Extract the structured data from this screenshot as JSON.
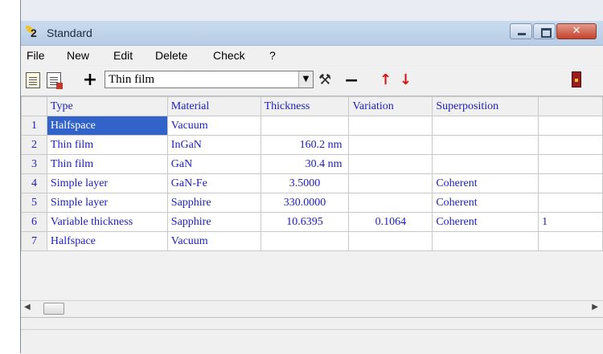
{
  "window": {
    "title": "Standard",
    "min_glyph": "",
    "max_glyph": "",
    "close_glyph": "✕"
  },
  "menu": [
    "File",
    "New",
    "Edit",
    "Delete",
    "Check",
    "?"
  ],
  "toolbar": {
    "layer_type_value": "Thin film",
    "dropdown_glyph": "▼",
    "plus_glyph": "+",
    "minus_glyph": "−",
    "up_glyph": "↑",
    "down_glyph": "↓",
    "wand_glyph": "⚒"
  },
  "table": {
    "columns": [
      "Type",
      "Material",
      "Thickness",
      "Variation",
      "Superposition",
      ""
    ],
    "rows": [
      {
        "n": "1",
        "type": "Halfspace",
        "material": "Vacuum",
        "thickness": "",
        "variation": "",
        "superposition": "",
        "extra": ""
      },
      {
        "n": "2",
        "type": "Thin film",
        "material": "InGaN",
        "thickness": "160.2 nm",
        "variation": "",
        "superposition": "",
        "extra": ""
      },
      {
        "n": "3",
        "type": "Thin film",
        "material": "GaN",
        "thickness": "30.4 nm",
        "variation": "",
        "superposition": "",
        "extra": ""
      },
      {
        "n": "4",
        "type": "Simple layer",
        "material": "GaN-Fe",
        "thickness": "3.5000",
        "variation": "",
        "superposition": "Coherent",
        "extra": ""
      },
      {
        "n": "5",
        "type": "Simple layer",
        "material": "Sapphire",
        "thickness": "330.0000",
        "variation": "",
        "superposition": "Coherent",
        "extra": ""
      },
      {
        "n": "6",
        "type": "Variable thickness",
        "material": "Sapphire",
        "thickness": "10.6395",
        "variation": "0.1064",
        "superposition": "Coherent",
        "extra": "1"
      },
      {
        "n": "7",
        "type": "Halfspace",
        "material": "Vacuum",
        "thickness": "",
        "variation": "",
        "superposition": "",
        "extra": ""
      }
    ]
  },
  "scroll": {
    "left_glyph": "◀",
    "right_glyph": "▶"
  },
  "icons": [
    "app-icon",
    "new-document-icon",
    "copy-document-icon",
    "add-layer-icon",
    "tools-icon",
    "remove-layer-icon",
    "move-up-icon",
    "move-down-icon",
    "exit-icon"
  ],
  "colors": {
    "cell_text": "#1d1dbe",
    "selection": "#3163c8",
    "titlebar": "#c9dbef",
    "close_button": "#c3432c"
  }
}
